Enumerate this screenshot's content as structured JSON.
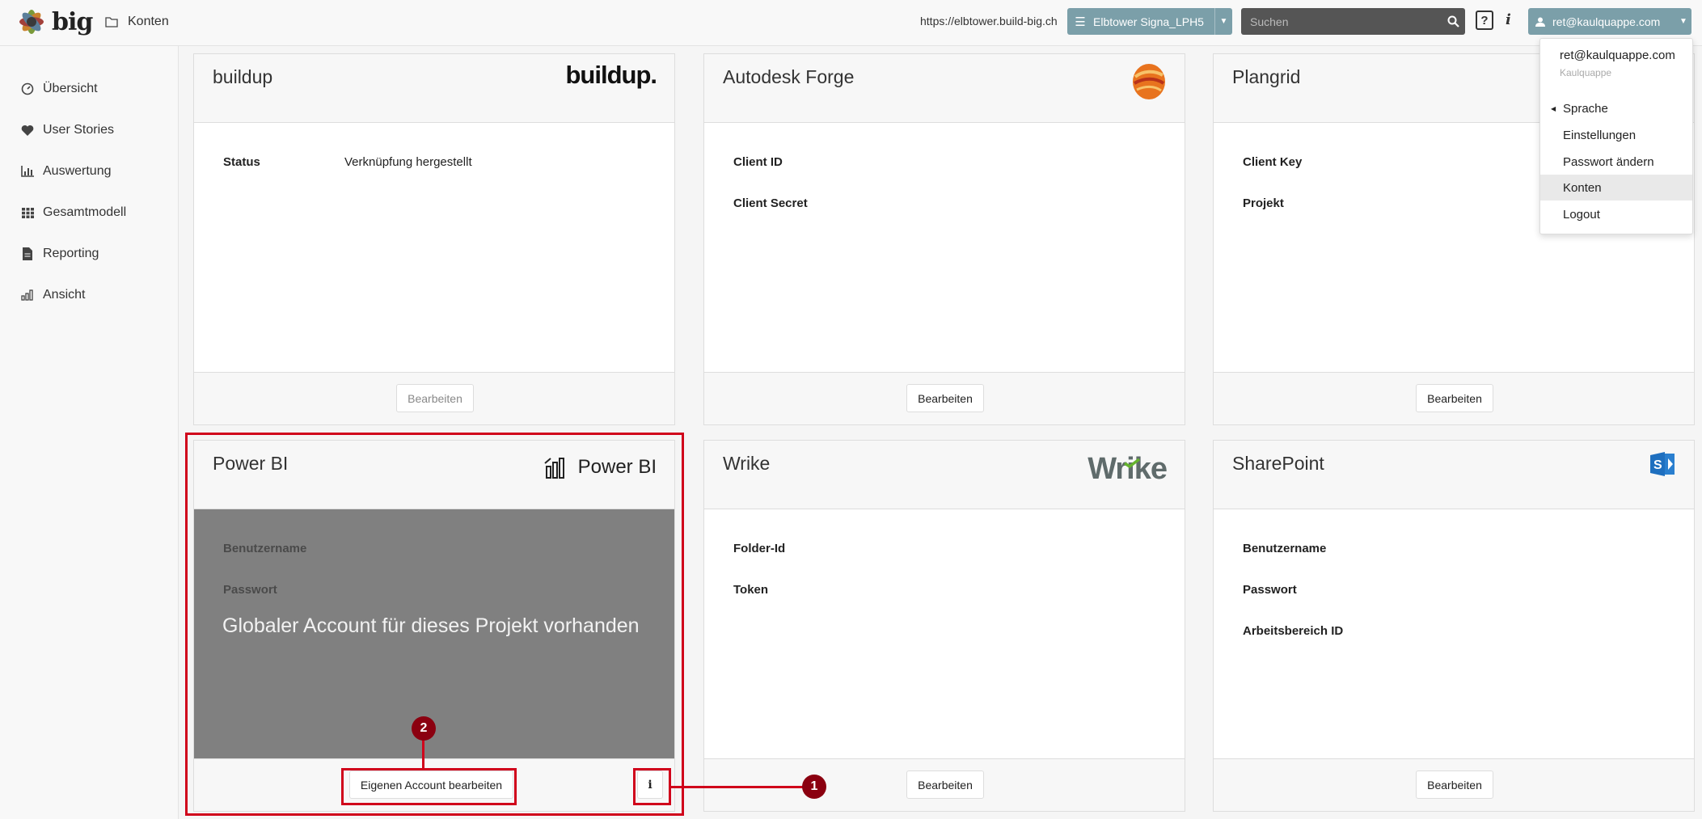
{
  "header": {
    "logo_text": "big",
    "page_title": "Konten",
    "url": "https://elbtower.build-big.ch",
    "project": "Elbtower Signa_LPH5",
    "search_placeholder": "Suchen",
    "help_label": "?",
    "info_label": "i",
    "user": "ret@kaulquappe.com"
  },
  "sidebar": {
    "items": [
      {
        "label": "Übersicht",
        "icon": "dashboard-icon"
      },
      {
        "label": "User Stories",
        "icon": "heart-icon"
      },
      {
        "label": "Auswertung",
        "icon": "bar-chart-icon"
      },
      {
        "label": "Gesamtmodell",
        "icon": "grid-icon"
      },
      {
        "label": "Reporting",
        "icon": "document-icon"
      },
      {
        "label": "Ansicht",
        "icon": "view-chart-icon"
      }
    ]
  },
  "cards": {
    "buildup": {
      "title": "buildup",
      "logo_text": "buildup.",
      "fields": [
        {
          "label": "Status",
          "value": "Verknüpfung hergestellt"
        }
      ],
      "button": "Bearbeiten"
    },
    "autodesk": {
      "title": "Autodesk Forge",
      "fields": [
        {
          "label": "Client ID"
        },
        {
          "label": "Client Secret"
        }
      ],
      "button": "Bearbeiten"
    },
    "plangrid": {
      "title": "Plangrid",
      "fields": [
        {
          "label": "Client Key"
        },
        {
          "label": "Projekt"
        }
      ],
      "button": "Bearbeiten"
    },
    "powerbi": {
      "title": "Power BI",
      "logo_text": "Power BI",
      "fields": [
        {
          "label": "Benutzername"
        },
        {
          "label": "Passwort"
        }
      ],
      "overlay_message": "Globaler Account für dieses Projekt vorhanden",
      "button": "Eigenen Account bearbeiten",
      "info_button": "i"
    },
    "wrike": {
      "title": "Wrike",
      "logo_text": "Wrike",
      "fields": [
        {
          "label": "Folder-Id"
        },
        {
          "label": "Token"
        }
      ],
      "button": "Bearbeiten"
    },
    "sharepoint": {
      "title": "SharePoint",
      "fields": [
        {
          "label": "Benutzername"
        },
        {
          "label": "Passwort"
        },
        {
          "label": "Arbeitsbereich ID"
        }
      ],
      "button": "Bearbeiten"
    }
  },
  "annotations": {
    "callout_1": "1",
    "callout_2": "2",
    "highlight_color": "#d0021b"
  },
  "user_menu": {
    "email": "ret@kaulquappe.com",
    "org": "Kaulquappe",
    "items": [
      "Sprache",
      "Einstellungen",
      "Passwort ändern",
      "Konten",
      "Logout"
    ],
    "active": "Konten"
  },
  "colors": {
    "accent": "#7b9fa9",
    "search_bg": "#555555",
    "callout": "#8b0010"
  }
}
